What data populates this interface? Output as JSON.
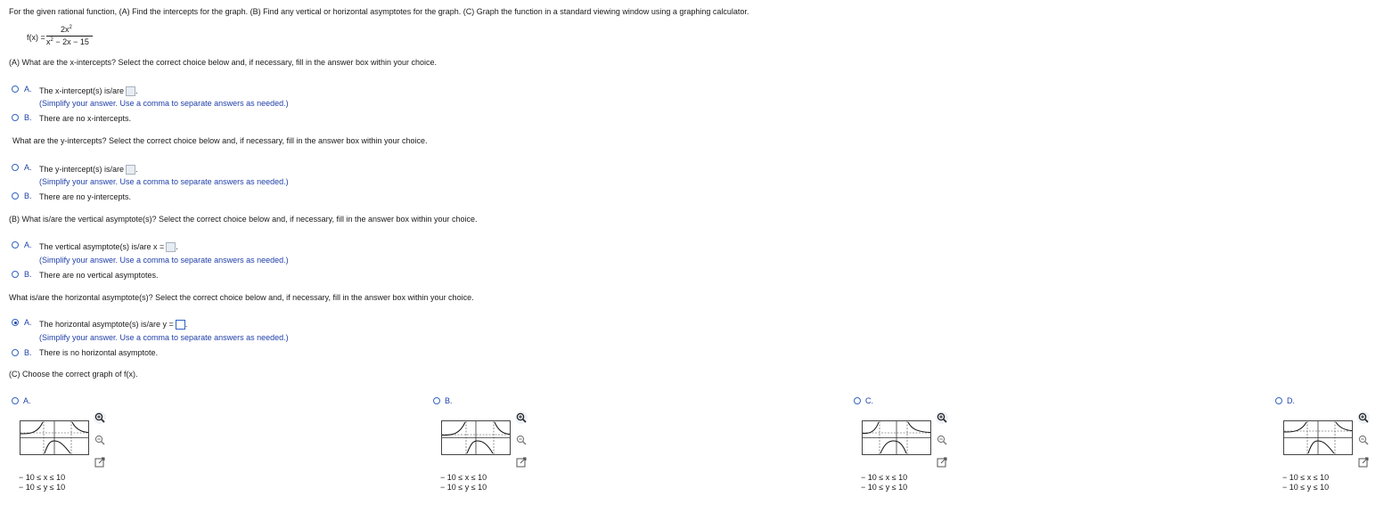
{
  "question": {
    "prompt": "For the given rational function, (A) Find the intercepts for the graph. (B) Find any vertical or horizontal asymptotes for the graph. (C) Graph the function in a standard viewing window using a graphing calculator.",
    "function_lhs": "f(x) =",
    "numerator_base": "2x",
    "numerator_exp": "2",
    "denominator_base": "x",
    "denominator_exp": "2",
    "denominator_rest": " − 2x − 15"
  },
  "hint_text": "(Simplify your answer. Use a comma to separate answers as needed.)",
  "parts": [
    {
      "question": "(A) What are the x-intercepts? Select the correct choice below and, if necessary, fill in the answer box within your choice.",
      "options": [
        {
          "letter": "A.",
          "text": "The x-intercept(s) is/are",
          "suffix": ".",
          "selected": false
        },
        {
          "letter": "B.",
          "text": "There are no x-intercepts.",
          "selected": false
        }
      ]
    },
    {
      "question": "What are the y-intercepts? Select the correct choice below and, if necessary, fill in the answer box within your choice.",
      "options": [
        {
          "letter": "A.",
          "text": "The y-intercept(s) is/are",
          "suffix": ".",
          "selected": false
        },
        {
          "letter": "B.",
          "text": "There are no y-intercepts.",
          "selected": false
        }
      ]
    },
    {
      "question": "(B) What is/are the vertical asymptote(s)? Select the correct choice below and, if necessary, fill in the answer box within your choice.",
      "options": [
        {
          "letter": "A.",
          "text": "The vertical asymptote(s) is/are x =",
          "suffix": ".",
          "selected": false
        },
        {
          "letter": "B.",
          "text": "There are no vertical asymptotes.",
          "selected": false
        }
      ]
    },
    {
      "question": "What is/are the horizontal asymptote(s)? Select the correct choice below and, if necessary, fill in the answer box within your choice.",
      "options": [
        {
          "letter": "A.",
          "text": "The horizontal asymptote(s) is/are y =",
          "suffix": ".",
          "selected": true
        },
        {
          "letter": "B.",
          "text": "There is no horizontal asymptote.",
          "selected": false
        }
      ]
    }
  ],
  "graph_part": {
    "question": "(C) Choose the correct graph of f(x).",
    "options": [
      {
        "letter": "A.",
        "x_range": "− 10 ≤ x ≤ 10",
        "y_range": "− 10 ≤ y ≤ 10",
        "selected": false
      },
      {
        "letter": "B.",
        "x_range": "− 10 ≤ x ≤ 10",
        "y_range": "− 10 ≤ y ≤ 10",
        "selected": false
      },
      {
        "letter": "C.",
        "x_range": "− 10 ≤ x ≤ 10",
        "y_range": "− 10 ≤ y ≤ 10",
        "selected": false
      },
      {
        "letter": "D.",
        "x_range": "− 10 ≤ x ≤ 10",
        "y_range": "− 10 ≤ y ≤ 10",
        "selected": false
      }
    ]
  },
  "colors": {
    "accent": "#1f3fa8",
    "radio_border": "#3565c2",
    "answer_box": "#e8edf3"
  },
  "icons": [
    "zoom-in-icon",
    "zoom-out-icon",
    "pop-out-icon"
  ]
}
